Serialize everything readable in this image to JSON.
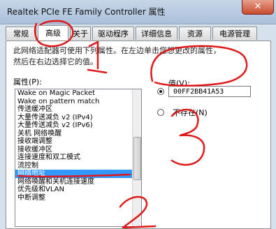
{
  "window": {
    "title": "Realtek PCIe FE Family Controller 属性",
    "close_glyph": "✕"
  },
  "tabs": [
    {
      "label": "常规"
    },
    {
      "label": "高级"
    },
    {
      "label": "关于"
    },
    {
      "label": "驱动程序"
    },
    {
      "label": "详细信息"
    },
    {
      "label": "资源"
    },
    {
      "label": "电源管理"
    }
  ],
  "active_tab": "高级",
  "advanced": {
    "description_line1": "此网络适配器可使用下列属性。在左边单击您想更改的属性，",
    "description_line2": "然后在右边选择它的值。",
    "property_label": "属性(P):",
    "properties": [
      "Wake on Magic Packet",
      "Wake on pattern match",
      "传送缓冲区",
      "大量传送减负 v2 (IPv4)",
      "大量传送减负 v2 (IPv6)",
      "关机 网络唤醒",
      "接收端调整",
      "接收缓冲区",
      "连接速度和双工模式",
      "流控制",
      "网络地址",
      "网络唤醒和关机连接速度",
      "优先级和VLAN",
      "中断调整"
    ],
    "selected_property": "网络地址",
    "value_label": "值(V):",
    "value": "00FF2BB41A53",
    "not_present_label": "不存在(N)",
    "value_radio_checked": true
  },
  "annotations": {
    "ink_color": "#e01818",
    "marks": [
      "1",
      "2",
      "3"
    ]
  }
}
